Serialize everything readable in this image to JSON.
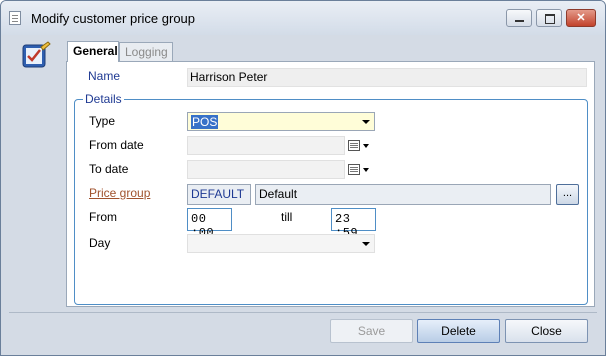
{
  "window": {
    "title": "Modify customer price group",
    "controls": {
      "minimize": "",
      "maximize": "",
      "close": "✕"
    }
  },
  "tabs": [
    {
      "label": "General",
      "active": true
    },
    {
      "label": "Logging",
      "active": false
    }
  ],
  "form": {
    "name_label": "Name",
    "name_value": "Harrison Peter",
    "details_group": "Details",
    "type_label": "Type",
    "type_value": "POS",
    "from_date_label": "From date",
    "from_date_value": "",
    "to_date_label": "To date",
    "to_date_value": "",
    "price_group_label": "Price group",
    "price_group_code": "DEFAULT",
    "price_group_name": "Default",
    "browse_label": "...",
    "from_label": "From",
    "from_time": "00 :00",
    "till_label": "till",
    "till_time": "23 :59",
    "day_label": "Day",
    "day_value": ""
  },
  "buttons": {
    "save": "Save",
    "delete": "Delete",
    "close": "Close"
  },
  "colors": {
    "accent_blue": "#4f8ec6",
    "link_label": "#a0522d",
    "highlight": "#3771c8"
  }
}
